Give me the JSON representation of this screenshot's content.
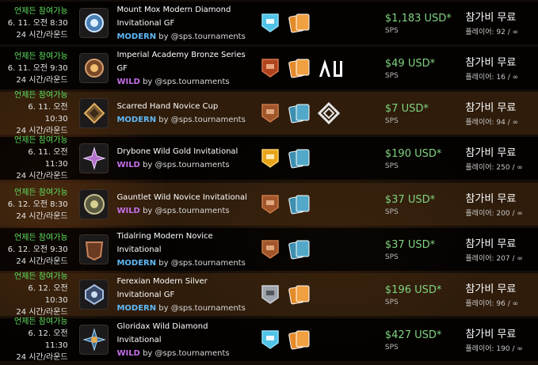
{
  "rows": [
    {
      "status": "언제든 참여가능",
      "date": "6. 11. 오전 8:30",
      "round": "24 시간/라운드",
      "name": "Mount Mox Modern Diamond Invitational GF",
      "format": "MODERN",
      "by": "by @sps.tournaments",
      "league_badge": "diamond-league-icon",
      "league_color": "#4fc3e8",
      "card_sets": [
        "orange-card-set-icon"
      ],
      "extra_icon": null,
      "prize": "$1,183 USD*",
      "currency": "SPS",
      "entry": "참가비 무료",
      "players": "플레이어: 92 / ∞"
    },
    {
      "status": "언제든 참여가능",
      "date": "6. 11. 오전 9:30",
      "round": "24 시간/라운드",
      "name": "Imperial Academy Bronze Series GF",
      "format": "WILD",
      "by": "by @sps.tournaments",
      "league_badge": "bronze-league-icon",
      "league_color": "#b0441f",
      "card_sets": [
        "orange-card-set-icon"
      ],
      "extra_icon": "au-logo-icon",
      "prize": "$49 USD*",
      "currency": "SPS",
      "entry": "참가비 무료",
      "players": "플레이어: 16 / ∞"
    },
    {
      "status": "언제든 참여가능",
      "date": "6. 11. 오전 10:30",
      "round": "24 시간/라운드",
      "name": "Scarred Hand Novice Cup",
      "format": "MODERN",
      "by": "by @sps.tournaments",
      "league_badge": "novice-league-icon",
      "league_color": "#a0552a",
      "card_sets": [
        "blue-card-set-icon"
      ],
      "extra_icon": "diamond-knot-icon",
      "prize": "$7 USD*",
      "currency": "SPS",
      "entry": "참가비 무료",
      "players": "플레이어: 94 / ∞"
    },
    {
      "status": "언제든 참여가능",
      "date": "6. 11. 오전 11:30",
      "round": "24 시간/라운드",
      "name": "Drybone Wild Gold Invitational",
      "format": "WILD",
      "by": "by @sps.tournaments",
      "league_badge": "gold-league-icon",
      "league_color": "#e8a519",
      "card_sets": [
        "blue-card-set-icon"
      ],
      "extra_icon": null,
      "prize": "$190 USD*",
      "currency": "SPS",
      "entry": "참가비 무료",
      "players": "플레이어: 250 / ∞"
    },
    {
      "status": "언제든 참여가능",
      "date": "6. 12. 오전 8:30",
      "round": "24 시간/라운드",
      "name": "Gauntlet Wild Novice Invitational",
      "format": "WILD",
      "by": "by @sps.tournaments",
      "league_badge": "novice-league-icon",
      "league_color": "#a0552a",
      "card_sets": [
        "blue-card-set-icon"
      ],
      "extra_icon": null,
      "prize": "$37 USD*",
      "currency": "SPS",
      "entry": "참가비 무료",
      "players": "플레이어: 200 / ∞"
    },
    {
      "status": "언제든 참여가능",
      "date": "6. 12. 오전 9:30",
      "round": "24 시간/라운드",
      "name": "Tidalring Modern Novice Invitational",
      "format": "MODERN",
      "by": "by @sps.tournaments",
      "league_badge": "novice-league-icon",
      "league_color": "#a0552a",
      "card_sets": [
        "blue-card-set-icon"
      ],
      "extra_icon": null,
      "prize": "$37 USD*",
      "currency": "SPS",
      "entry": "참가비 무료",
      "players": "플레이어: 207 / ∞"
    },
    {
      "status": "언제든 참여가능",
      "date": "6. 12. 오전 10:30",
      "round": "24 시간/라운드",
      "name": "Ferexian Modern Silver Invitational GF",
      "format": "MODERN",
      "by": "by @sps.tournaments",
      "league_badge": "silver-league-icon",
      "league_color": "#9ea3ab",
      "card_sets": [
        "orange-card-set-icon"
      ],
      "extra_icon": null,
      "prize": "$196 USD*",
      "currency": "SPS",
      "entry": "참가비 무료",
      "players": "플레이어: 96 / ∞"
    },
    {
      "status": "언제든 참여가능",
      "date": "6. 12. 오전 11:30",
      "round": "24 시간/라운드",
      "name": "Gloridax Wild Diamond Invitational",
      "format": "WILD",
      "by": "by @sps.tournaments",
      "league_badge": "diamond-league-icon",
      "league_color": "#4fc3e8",
      "card_sets": [
        "orange-card-set-icon"
      ],
      "extra_icon": null,
      "prize": "$427 USD*",
      "currency": "SPS",
      "entry": "참가비 무료",
      "players": "플레이어: 190 / ∞"
    }
  ]
}
